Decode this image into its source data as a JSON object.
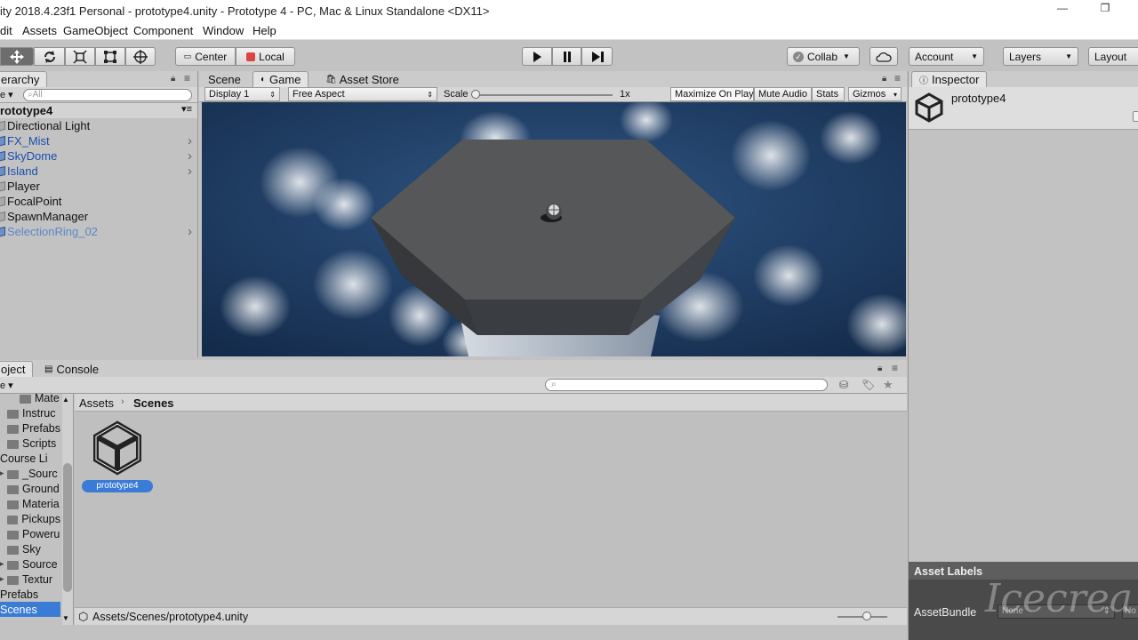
{
  "window": {
    "title": "ity 2018.4.23f1 Personal - prototype4.unity - Prototype 4 - PC, Mac & Linux Standalone <DX11>",
    "minimize": "—",
    "restore": "❐"
  },
  "menu": [
    "dit",
    "Assets",
    "GameObject",
    "Component",
    "Window",
    "Help"
  ],
  "toolbar": {
    "center_label": "Center",
    "local_label": "Local",
    "collab_label": "Collab",
    "account_label": "Account",
    "layers_label": "Layers",
    "layout_label": "Layout"
  },
  "hierarchy": {
    "tab_label": "erarchy",
    "create_label": "e",
    "search_placeholder": "All",
    "scene_name": "rototype4",
    "items": [
      {
        "label": "Directional Light",
        "prefab": false,
        "children": false
      },
      {
        "label": "FX_Mist",
        "prefab": true,
        "children": true
      },
      {
        "label": "SkyDome",
        "prefab": true,
        "children": true
      },
      {
        "label": "Island",
        "prefab": true,
        "children": true
      },
      {
        "label": "Player",
        "prefab": false,
        "children": false
      },
      {
        "label": "FocalPoint",
        "prefab": false,
        "children": false
      },
      {
        "label": "SpawnManager",
        "prefab": false,
        "children": false
      },
      {
        "label": "SelectionRing_02",
        "prefab": true,
        "children": true
      }
    ]
  },
  "viewport": {
    "tabs": [
      "Scene",
      "Game",
      "Asset Store"
    ],
    "active_tab": "Game",
    "display": "Display 1",
    "aspect": "Free Aspect",
    "scale_label": "Scale",
    "scale_value": "1x",
    "buttons": [
      "Maximize On Play",
      "Mute Audio",
      "Stats",
      "Gizmos"
    ]
  },
  "inspector": {
    "tab_label": "Inspector",
    "asset_name": "prototype4",
    "asset_labels": "Asset Labels",
    "asset_bundle_label": "AssetBundle",
    "asset_bundle_value": "None",
    "cut_label": "No"
  },
  "project": {
    "tab_label": "oject",
    "console_label": "Console",
    "create_label": "e",
    "tree": [
      {
        "label": "Mate",
        "indent": 2
      },
      {
        "label": "Instruc",
        "indent": 1
      },
      {
        "label": "Prefabs",
        "indent": 1
      },
      {
        "label": "Scripts",
        "indent": 1
      },
      {
        "label": "Course Li",
        "indent": 0
      },
      {
        "label": "_Sourc",
        "indent": 1
      },
      {
        "label": "Ground",
        "indent": 1
      },
      {
        "label": "Materia",
        "indent": 1
      },
      {
        "label": "Pickups",
        "indent": 1
      },
      {
        "label": "Poweru",
        "indent": 1
      },
      {
        "label": "Sky",
        "indent": 1
      },
      {
        "label": "Source",
        "indent": 1
      },
      {
        "label": "Textur",
        "indent": 1
      },
      {
        "label": "Prefabs",
        "indent": 0
      },
      {
        "label": "Scenes",
        "indent": 0
      }
    ],
    "selected_tree": "Scenes",
    "breadcrumb": [
      "Assets",
      "Scenes"
    ],
    "asset_item": "prototype4",
    "status_path": "Assets/Scenes/prototype4.unity"
  },
  "watermark": "Icecrea"
}
